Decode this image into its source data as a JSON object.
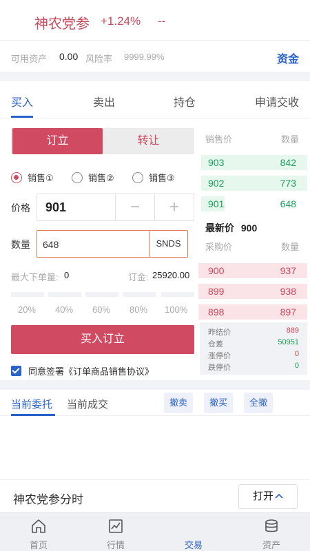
{
  "header": {
    "name": "神农党参",
    "change": "+1.24%",
    "dash": "--"
  },
  "assets": {
    "available_label": "可用资产",
    "available_value": "0.00",
    "risk_label": "风险率",
    "risk_value": "9999.99%",
    "fund_link": "资金"
  },
  "tabs": [
    "买入",
    "卖出",
    "持仓",
    "申请交收"
  ],
  "toggle": {
    "active": "订立",
    "inactive": "转让"
  },
  "radios": [
    {
      "label": "销售①",
      "checked": true
    },
    {
      "label": "销售②",
      "checked": false
    },
    {
      "label": "销售③",
      "checked": false
    }
  ],
  "form": {
    "price_label": "价格",
    "price_value": "901",
    "minus": "−",
    "plus": "+",
    "qty_label": "数量",
    "qty_value": "648",
    "qty_unit": "SNDS",
    "max_label": "最大下单量:",
    "max_value": "0",
    "deposit_label": "订金:",
    "deposit_value": "25920.00",
    "percents": [
      "20%",
      "40%",
      "60%",
      "80%",
      "100%"
    ],
    "submit": "买入订立",
    "agree_text": "同意签署《订单商品销售协议》"
  },
  "book": {
    "sell_header_price": "销售价",
    "sell_header_qty": "数量",
    "sells": [
      {
        "price": "903",
        "qty": "842"
      },
      {
        "price": "902",
        "qty": "773"
      },
      {
        "price": "901",
        "qty": "648"
      }
    ],
    "latest_label": "最新价",
    "latest_value": "900",
    "buy_header_price": "采购价",
    "buy_header_qty": "数量",
    "buys": [
      {
        "price": "900",
        "qty": "937"
      },
      {
        "price": "899",
        "qty": "938"
      },
      {
        "price": "898",
        "qty": "897"
      }
    ]
  },
  "stats": [
    {
      "label": "昨结价",
      "value": "889",
      "color": "#c8485a"
    },
    {
      "label": "仓差",
      "value": "50951",
      "color": "#1b9e5a"
    },
    {
      "label": "涨停价",
      "value": "0",
      "color": "#c8485a"
    },
    {
      "label": "跌停价",
      "value": "0",
      "color": "#1b9e5a"
    }
  ],
  "orders": {
    "tab_current": "当前委托",
    "tab_deals": "当前成交",
    "cancel_sell": "撤卖",
    "cancel_buy": "撤买",
    "cancel_all": "全撤"
  },
  "chart_bar": {
    "title": "神农党参分时",
    "open": "打开",
    "chevron": "^"
  },
  "nav": [
    {
      "label": "首页",
      "icon": "home-icon"
    },
    {
      "label": "行情",
      "icon": "chart-icon"
    },
    {
      "label": "交易",
      "icon": "trade-icon"
    },
    {
      "label": "资产",
      "icon": "database-icon"
    }
  ],
  "colors": {
    "accent": "#2a62c9",
    "up": "#c8485a",
    "down": "#1b9e5a"
  }
}
